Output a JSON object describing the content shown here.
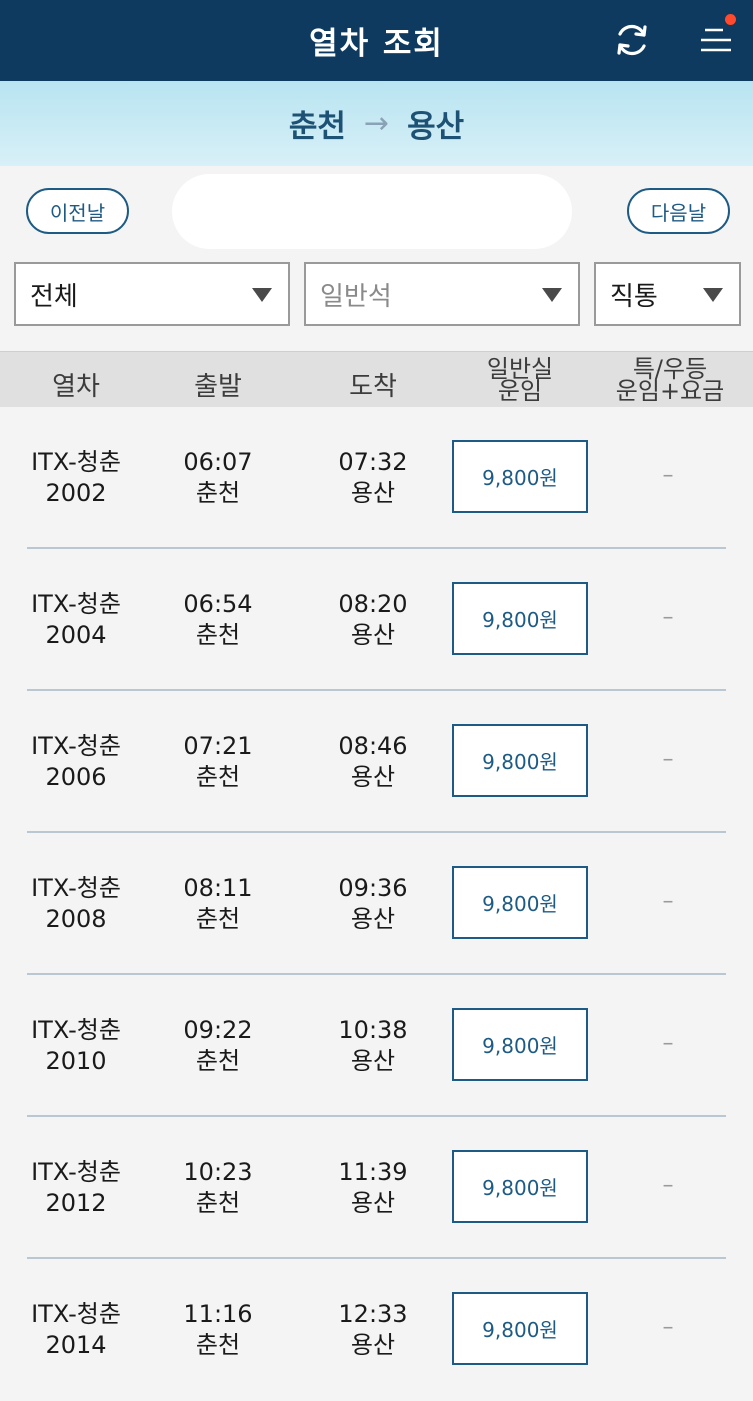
{
  "header": {
    "title": "열차 조회",
    "refresh_icon": "refresh-icon",
    "menu_icon": "menu-icon",
    "notification_color": "#ff4a2e"
  },
  "route": {
    "from": "춘천",
    "arrow": "→",
    "to": "용산"
  },
  "date_nav": {
    "prev_label": "이전날",
    "next_label": "다음날"
  },
  "filters": {
    "train_type": "전체",
    "seat_class": "일반석",
    "route_type": "직통"
  },
  "columns": {
    "train": "열차",
    "depart": "출발",
    "arrive": "도착",
    "standard_1": "일반실",
    "standard_2": "운임",
    "special_1": "특/우등",
    "special_2": "운임+요금"
  },
  "trains": [
    {
      "name": "ITX-청춘",
      "number": "2002",
      "dep_time": "06:07",
      "dep_station": "춘천",
      "arr_time": "07:32",
      "arr_station": "용산",
      "fare": "9,800원",
      "special": "–"
    },
    {
      "name": "ITX-청춘",
      "number": "2004",
      "dep_time": "06:54",
      "dep_station": "춘천",
      "arr_time": "08:20",
      "arr_station": "용산",
      "fare": "9,800원",
      "special": "–"
    },
    {
      "name": "ITX-청춘",
      "number": "2006",
      "dep_time": "07:21",
      "dep_station": "춘천",
      "arr_time": "08:46",
      "arr_station": "용산",
      "fare": "9,800원",
      "special": "–"
    },
    {
      "name": "ITX-청춘",
      "number": "2008",
      "dep_time": "08:11",
      "dep_station": "춘천",
      "arr_time": "09:36",
      "arr_station": "용산",
      "fare": "9,800원",
      "special": "–"
    },
    {
      "name": "ITX-청춘",
      "number": "2010",
      "dep_time": "09:22",
      "dep_station": "춘천",
      "arr_time": "10:38",
      "arr_station": "용산",
      "fare": "9,800원",
      "special": "–"
    },
    {
      "name": "ITX-청춘",
      "number": "2012",
      "dep_time": "10:23",
      "dep_station": "춘천",
      "arr_time": "11:39",
      "arr_station": "용산",
      "fare": "9,800원",
      "special": "–"
    },
    {
      "name": "ITX-청춘",
      "number": "2014",
      "dep_time": "11:16",
      "dep_station": "춘천",
      "arr_time": "12:33",
      "arr_station": "용산",
      "fare": "9,800원",
      "special": "–"
    }
  ],
  "colors": {
    "header_bg": "#0e3a5f",
    "accent": "#1e5b84",
    "route_bg": "#c6eaf4"
  }
}
